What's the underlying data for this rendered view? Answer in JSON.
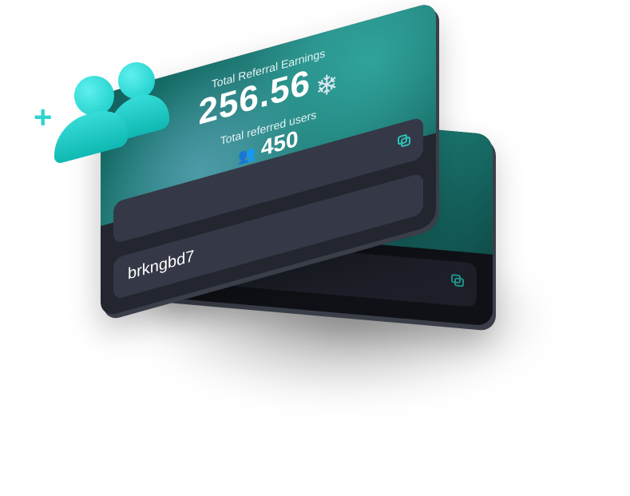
{
  "card": {
    "earnings_label": "Total Referral Earnings",
    "earnings_value": "256.56",
    "users_label": "Total referred users",
    "users_value": "450",
    "referral_code": "brkngbd7"
  },
  "colors": {
    "accent": "#2bc4b6",
    "card_dark": "#23262f",
    "teal": "#1c7a73"
  }
}
